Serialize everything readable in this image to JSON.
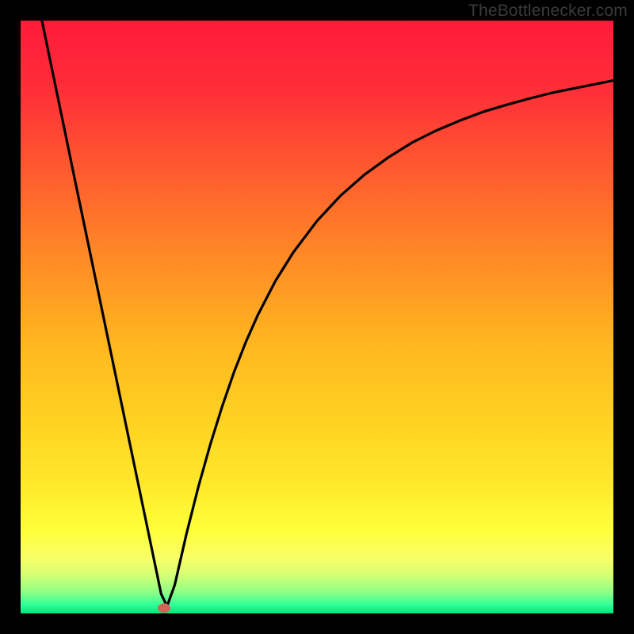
{
  "watermark_text": "TheBottlenecker.com",
  "chart_data": {
    "type": "line",
    "title": "",
    "xlabel": "",
    "ylabel": "",
    "xlim": [
      0,
      100
    ],
    "ylim": [
      0,
      100
    ],
    "legend": false,
    "grid": false,
    "background_gradient": {
      "stops": [
        {
          "offset": 0.0,
          "color": "#ff1a3a"
        },
        {
          "offset": 0.12,
          "color": "#ff2f38"
        },
        {
          "offset": 0.25,
          "color": "#ff5a2f"
        },
        {
          "offset": 0.4,
          "color": "#ff8a26"
        },
        {
          "offset": 0.55,
          "color": "#ffb81f"
        },
        {
          "offset": 0.68,
          "color": "#ffd321"
        },
        {
          "offset": 0.78,
          "color": "#ffe82a"
        },
        {
          "offset": 0.86,
          "color": "#ffff3a"
        },
        {
          "offset": 0.905,
          "color": "#f9ff66"
        },
        {
          "offset": 0.935,
          "color": "#d6ff75"
        },
        {
          "offset": 0.965,
          "color": "#8cff86"
        },
        {
          "offset": 0.985,
          "color": "#33ff99"
        },
        {
          "offset": 1.0,
          "color": "#00e67a"
        }
      ]
    },
    "marker": {
      "x": 24.2,
      "y": 0.9,
      "color": "#cc6655"
    },
    "curve": {
      "x": [
        3.6,
        5,
        7,
        9,
        11,
        13,
        15,
        17,
        19,
        21,
        22,
        23,
        23.7,
        24.7,
        26,
        28,
        30,
        32,
        34,
        36,
        38,
        40,
        43,
        46,
        50,
        54,
        58,
        62,
        66,
        70,
        74,
        78,
        82,
        86,
        90,
        94,
        98,
        100
      ],
      "y": [
        100,
        93.2,
        83.6,
        73.9,
        64.3,
        54.7,
        45.1,
        35.5,
        25.9,
        16.3,
        11.5,
        6.7,
        3.3,
        1.2,
        4.8,
        13.5,
        21.4,
        28.5,
        34.9,
        40.7,
        45.8,
        50.3,
        56.1,
        60.9,
        66.2,
        70.5,
        74.0,
        76.9,
        79.4,
        81.4,
        83.1,
        84.6,
        85.8,
        86.9,
        87.9,
        88.7,
        89.5,
        89.9
      ]
    }
  }
}
